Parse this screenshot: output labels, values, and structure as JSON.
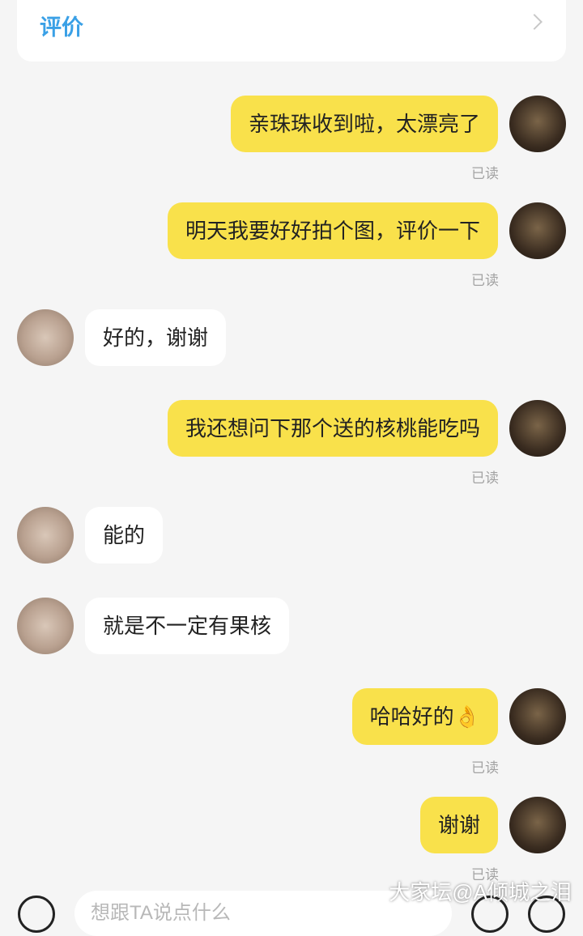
{
  "header": {
    "review_label": "评价"
  },
  "messages": [
    {
      "side": "me",
      "text": "亲珠珠收到啦，太漂亮了",
      "status": "已读"
    },
    {
      "side": "me",
      "text": "明天我要好好拍个图，评价一下",
      "status": "已读"
    },
    {
      "side": "them",
      "text": "好的，谢谢"
    },
    {
      "side": "me",
      "text": "我还想问下那个送的核桃能吃吗",
      "status": "已读"
    },
    {
      "side": "them",
      "text": "能的"
    },
    {
      "side": "them",
      "text": "就是不一定有果核"
    },
    {
      "side": "me",
      "text": "哈哈好的👌",
      "status": "已读"
    },
    {
      "side": "me",
      "text": "谢谢",
      "status": "已读"
    }
  ],
  "input": {
    "placeholder": "想跟TA说点什么"
  },
  "watermark": "大家坛@A倾城之泪",
  "colors": {
    "my_bubble": "#f9e14b",
    "their_bubble": "#ffffff",
    "accent": "#3aa0e6"
  }
}
